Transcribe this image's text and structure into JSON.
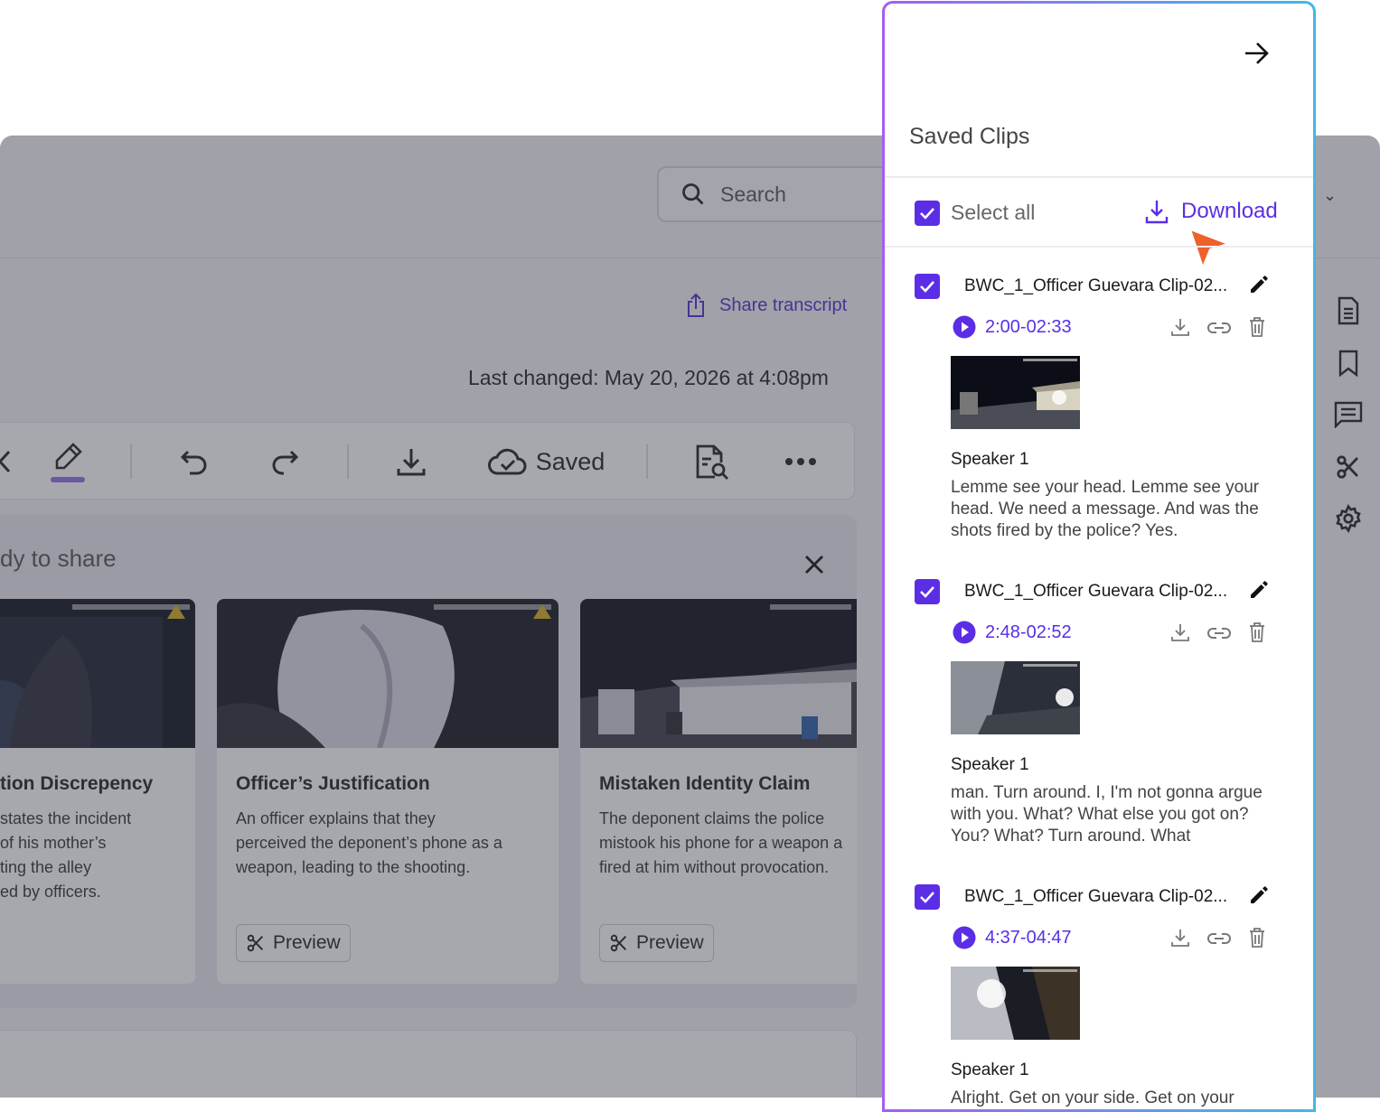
{
  "header": {
    "search_placeholder": "Search"
  },
  "actions": {
    "share_transcript": "Share transcript",
    "last_changed": "Last changed: May 20, 2026 at 4:08pm"
  },
  "toolbar": {
    "saved_label": "Saved"
  },
  "ready_panel": {
    "title": "dy to share",
    "cards": [
      {
        "title": "tion Discrepency",
        "lines": [
          " states the incident",
          " of his mother’s",
          "ting the alley",
          "ed by officers."
        ]
      },
      {
        "title": "Officer’s Justification",
        "lines": [
          "An officer explains that they",
          "perceived the deponent’s phone as a",
          "weapon, leading to the shooting."
        ],
        "preview_label": "Preview"
      },
      {
        "title": "Mistaken Identity Claim",
        "lines": [
          "The deponent claims the police",
          "mistook his phone for a weapon a",
          "fired at him without provocation."
        ],
        "preview_label": "Preview"
      }
    ]
  },
  "saved_clips": {
    "title": "Saved Clips",
    "select_all_label": "Select all",
    "download_label": "Download",
    "clips": [
      {
        "name": "BWC_1_Officer Guevara Clip-02...",
        "time": "2:00-02:33",
        "speaker": "Speaker 1",
        "transcript": "Lemme see your head. Lemme see your head. We need a message. And was the shots fired by the police? Yes."
      },
      {
        "name": "BWC_1_Officer Guevara Clip-02...",
        "time": "2:48-02:52",
        "speaker": "Speaker 1",
        "transcript": "man. Turn around. I, I'm not gonna argue with you. What? What else you got on? You? What? Turn around. What"
      },
      {
        "name": "BWC_1_Officer Guevara Clip-02...",
        "time": "4:37-04:47",
        "speaker": "Speaker 1",
        "transcript": "Alright. Get on your side. Get on your"
      }
    ]
  },
  "colors": {
    "accent": "#5b2ee6",
    "cursor": "#f0602a"
  }
}
